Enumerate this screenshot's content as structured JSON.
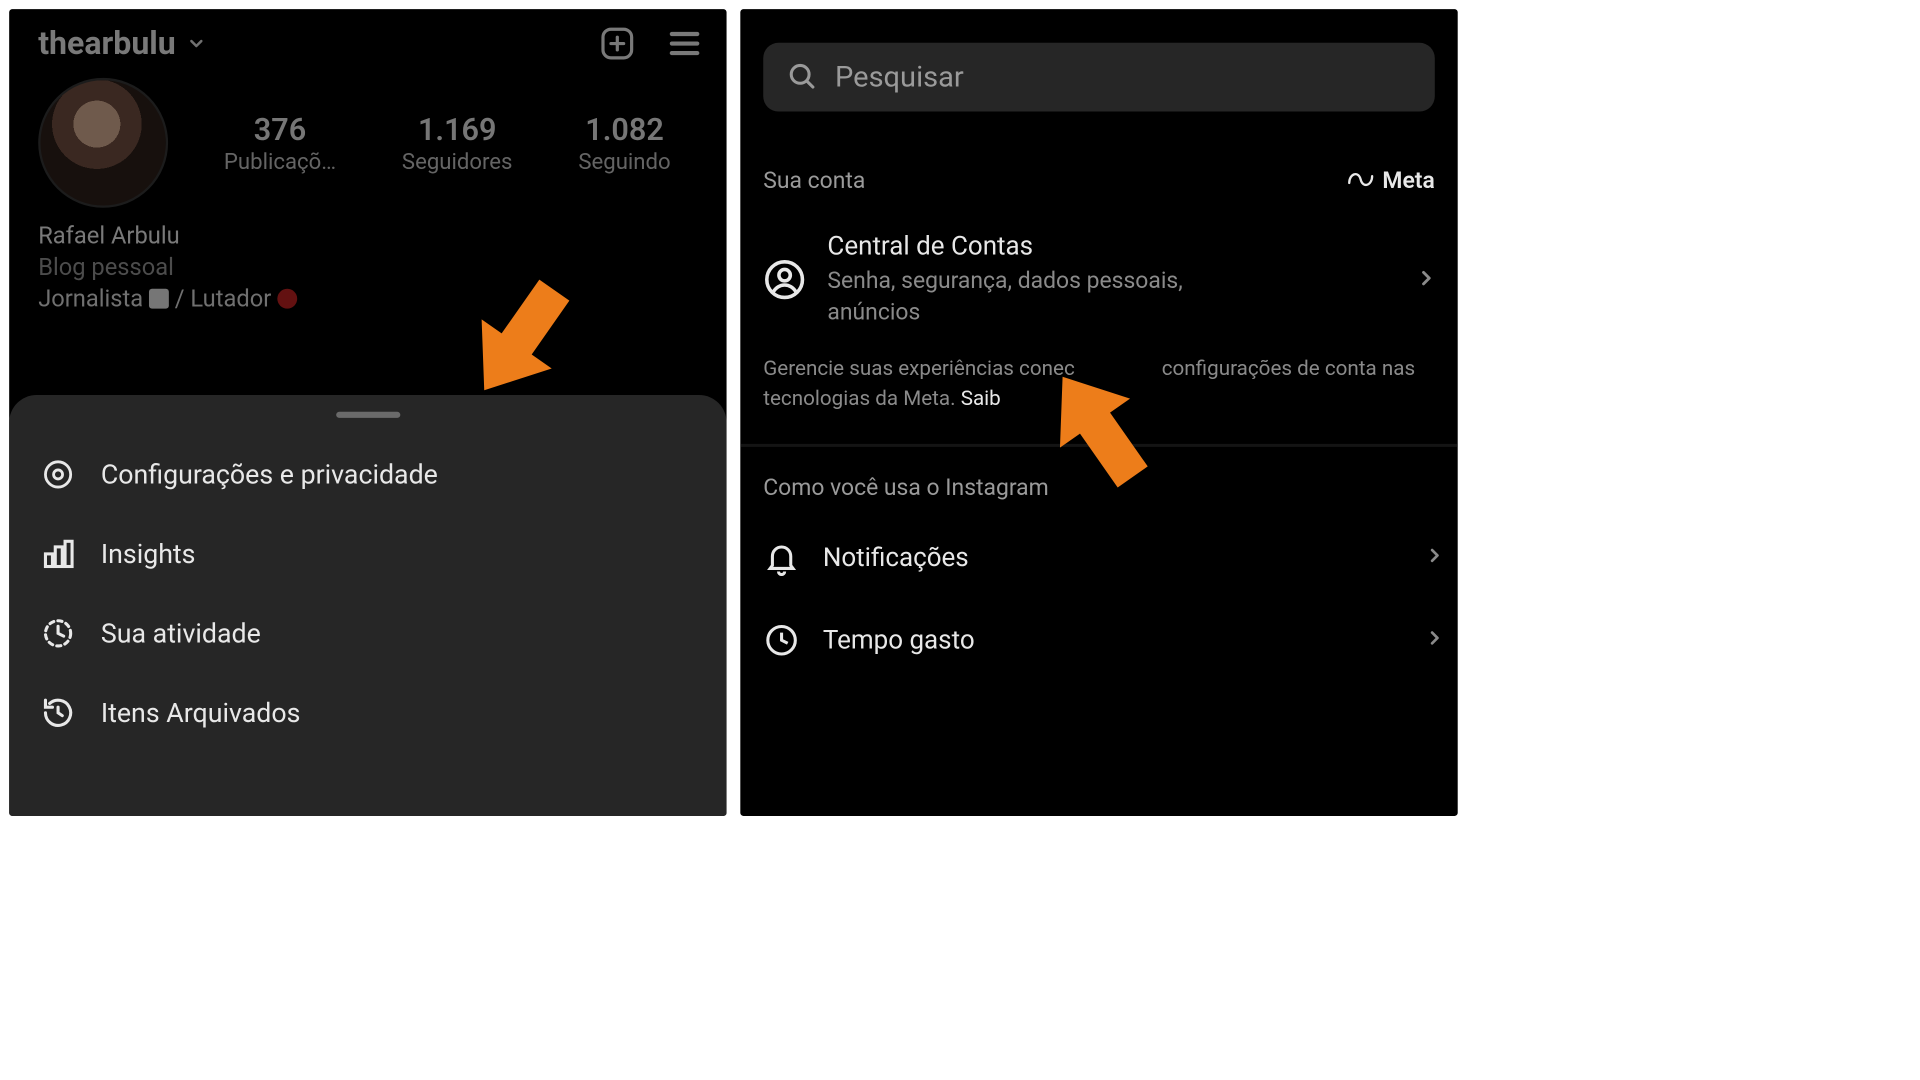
{
  "left": {
    "username": "thearbulu",
    "stats": {
      "posts": {
        "value": "376",
        "label": "Publicaçõ…"
      },
      "followers": {
        "value": "1.169",
        "label": "Seguidores"
      },
      "following": {
        "value": "1.082",
        "label": "Seguindo"
      }
    },
    "bio": {
      "display_name": "Rafael Arbulu",
      "category": "Blog pessoal",
      "line1_prefix": "Jornalista ",
      "line1_mid": " / Lutador "
    },
    "sheet": {
      "settings": "Configurações e privacidade",
      "insights": "Insights",
      "activity": "Sua atividade",
      "archived": "Itens Arquivados"
    }
  },
  "right": {
    "search_placeholder": "Pesquisar",
    "section_account": "Sua conta",
    "meta_brand": "Meta",
    "account_center": {
      "title": "Central de Contas",
      "subtitle": "Senha, segurança, dados pessoais, anúncios"
    },
    "manage_note_a": "Gerencie suas experiências conec",
    "manage_note_b": "configurações de conta nas tecnologias da Meta. ",
    "manage_note_link_prefix": "Saib",
    "section_usage": "Como você usa o Instagram",
    "items": {
      "notifications": "Notificações",
      "time_spent": "Tempo gasto"
    }
  }
}
